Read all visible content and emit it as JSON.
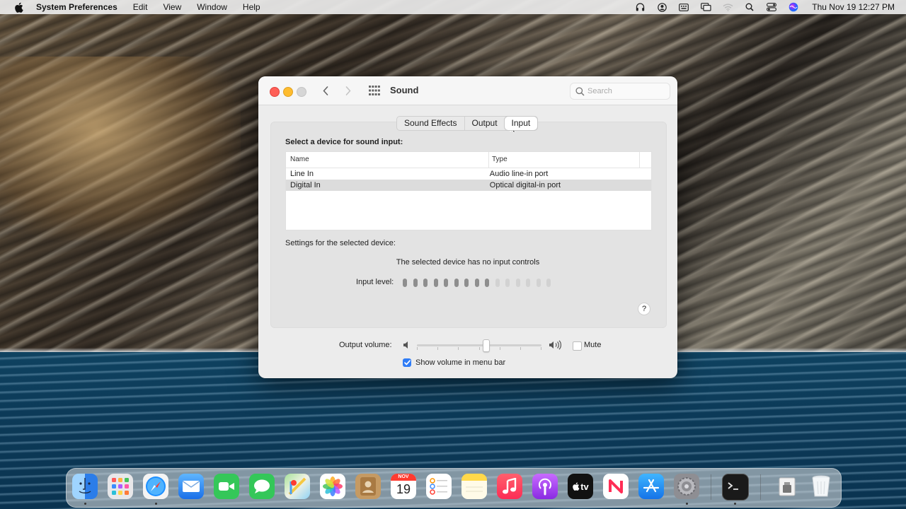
{
  "menubar": {
    "app_name": "System Preferences",
    "items": [
      "Edit",
      "View",
      "Window",
      "Help"
    ],
    "clock": "Thu Nov 19  12:27 PM",
    "status_icons": [
      "headphones-icon",
      "user-icon",
      "keyboard-icon",
      "screen-mirroring-icon",
      "wifi-icon",
      "search-icon",
      "control-center-icon",
      "siri-icon"
    ]
  },
  "window": {
    "title": "Sound",
    "search_placeholder": "Search",
    "tabs": [
      {
        "label": "Sound Effects",
        "active": false
      },
      {
        "label": "Output",
        "active": false
      },
      {
        "label": "Input",
        "active": true
      }
    ],
    "heading": "Select a device for sound input:",
    "table": {
      "columns": [
        "Name",
        "Type"
      ],
      "rows": [
        {
          "name": "Line In",
          "type": "Audio line-in port",
          "selected": false
        },
        {
          "name": "Digital In",
          "type": "Optical digital-in port",
          "selected": true
        }
      ]
    },
    "settings_label": "Settings for the selected device:",
    "no_controls": "The selected device has no input controls",
    "input_level_label": "Input level:",
    "input_level_active_segments": 9,
    "input_level_total_segments": 15,
    "help": "?",
    "output_volume_label": "Output volume:",
    "output_volume_fraction": 0.55,
    "mute_label": "Mute",
    "mute_checked": false,
    "show_volume_label": "Show volume in menu bar",
    "show_volume_checked": true
  },
  "dock": {
    "apps": [
      {
        "name": "finder-icon",
        "running": true
      },
      {
        "name": "launchpad-icon",
        "running": false
      },
      {
        "name": "safari-icon",
        "running": true
      },
      {
        "name": "mail-icon",
        "running": false
      },
      {
        "name": "facetime-icon",
        "running": false
      },
      {
        "name": "messages-icon",
        "running": false
      },
      {
        "name": "maps-icon",
        "running": false
      },
      {
        "name": "photos-icon",
        "running": false
      },
      {
        "name": "contacts-icon",
        "running": false
      },
      {
        "name": "calendar-icon",
        "running": false,
        "month": "NOV",
        "day": "19"
      },
      {
        "name": "reminders-icon",
        "running": false
      },
      {
        "name": "notes-icon",
        "running": false
      },
      {
        "name": "music-icon",
        "running": false
      },
      {
        "name": "podcasts-icon",
        "running": false
      },
      {
        "name": "apple-tv-icon",
        "running": false,
        "label": "tv"
      },
      {
        "name": "news-icon",
        "running": false
      },
      {
        "name": "app-store-icon",
        "running": false
      },
      {
        "name": "system-preferences-icon",
        "running": true
      },
      {
        "name": "terminal-icon",
        "running": true
      },
      {
        "name": "downloads-folder-icon",
        "running": false
      },
      {
        "name": "trash-icon",
        "running": false
      }
    ]
  },
  "colors": {
    "close": "#fe5f57",
    "minimize": "#febc2e",
    "accent": "#2f7cf6"
  }
}
